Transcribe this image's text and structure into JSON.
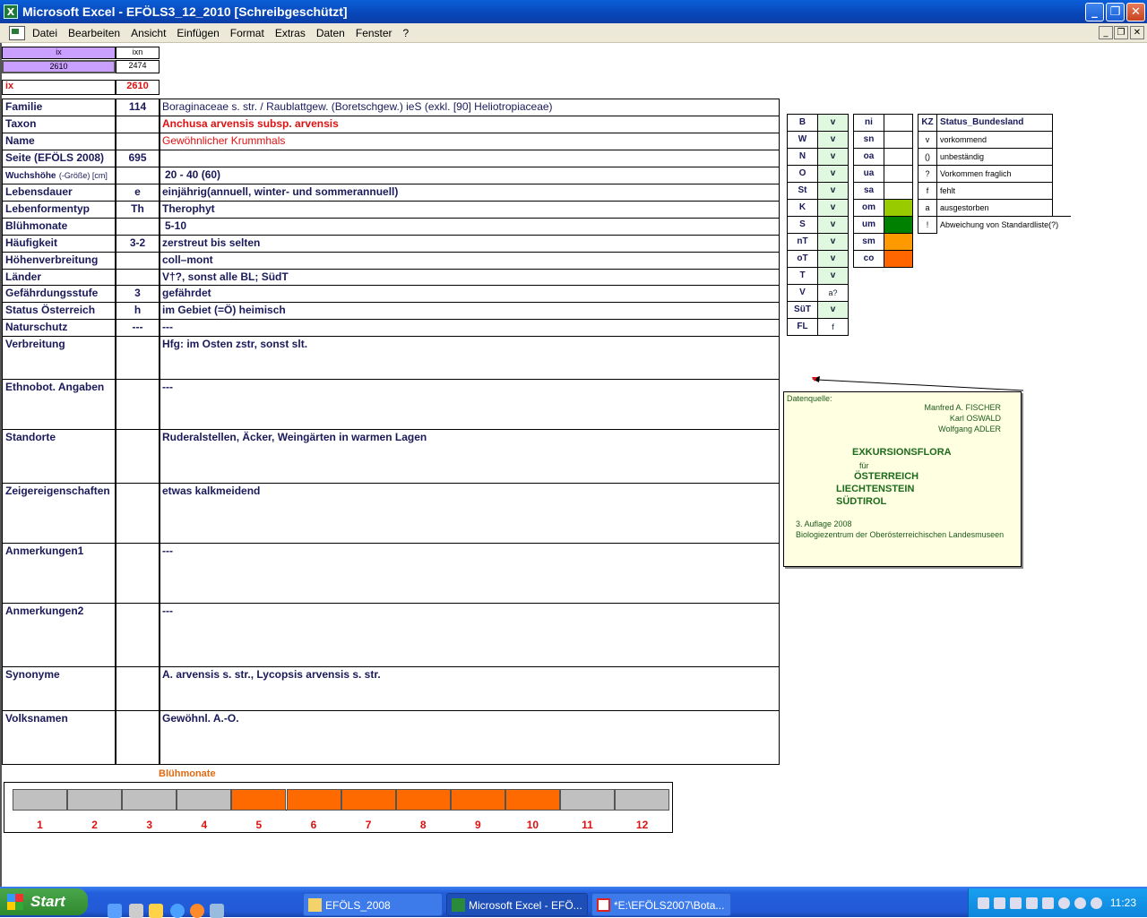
{
  "window": {
    "title": "Microsoft Excel - EFÖLS3_12_2010  [Schreibgeschützt]"
  },
  "menu": [
    "Datei",
    "Bearbeiten",
    "Ansicht",
    "Einfügen",
    "Format",
    "Extras",
    "Daten",
    "Fenster",
    "?"
  ],
  "top": {
    "ix_header": "ix",
    "ixn_header": "ixn",
    "ix_value": "2610",
    "ixn_value": "2474",
    "ix_label": "ix",
    "ix_red": "2610"
  },
  "rows": [
    {
      "label": "Familie",
      "code": "114",
      "value": "Boraginaceae s. str.  /  Raublattgew. (Boretschgew.) ieS (exkl. [90] Heliotropiaceae)"
    },
    {
      "label": "Taxon",
      "code": "",
      "value": "Anchusa arvensis subsp. arvensis"
    },
    {
      "label": "Name",
      "code": "",
      "value": "Gewöhnlicher Krummhals"
    },
    {
      "label": "Seite (EFÖLS 2008)",
      "code": "695",
      "value": ""
    },
    {
      "label": "Wuchshöhe",
      "label_suffix": "(-Größe) [cm]",
      "code": "",
      "value": "20 - 40 (60)"
    },
    {
      "label": "Lebensdauer",
      "code": "e",
      "value": "einjährig(annuell, winter- und sommerannuell)"
    },
    {
      "label": "Lebenformentyp",
      "code": "Th",
      "value": "Therophyt"
    },
    {
      "label": "Blühmonate",
      "code": "",
      "value": "5-10"
    },
    {
      "label": "Häufigkeit",
      "code": "3-2",
      "value": "zerstreut bis selten"
    },
    {
      "label": "Höhenverbreitung",
      "code": "",
      "value": "coll–mont"
    },
    {
      "label": "Länder",
      "code": "",
      "value": "V†?, sonst alle BL; SüdT"
    },
    {
      "label": "Gefährdungsstufe",
      "code": "3",
      "value": "gefährdet"
    },
    {
      "label": "Status Österreich",
      "code": "h",
      "value": "im Gebiet (=Ö) heimisch"
    },
    {
      "label": "Naturschutz",
      "code": "---",
      "value": "---"
    },
    {
      "label": "Verbreitung",
      "code": "",
      "value": "Hfg: im Osten zstr, sonst slt."
    },
    {
      "label": "Ethnobot. Angaben",
      "code": "",
      "value": "---"
    },
    {
      "label": "Standorte",
      "code": "",
      "value": "Ruderalstellen, Äcker, Weingärten in warmen Lagen"
    },
    {
      "label": "Zeigereigenschaften",
      "code": "",
      "value": "etwas kalkmeidend"
    },
    {
      "label": "Anmerkungen1",
      "code": "",
      "value": "---"
    },
    {
      "label": "Anmerkungen2",
      "code": "",
      "value": "---"
    },
    {
      "label": "Synonyme",
      "code": "",
      "value": "A. arvensis s. str., Lycopsis arvensis s. str."
    },
    {
      "label": "Volksnamen",
      "code": "",
      "value": "Gewöhnl. A.-O."
    }
  ],
  "states": [
    {
      "k": "B",
      "v": "v"
    },
    {
      "k": "W",
      "v": "v"
    },
    {
      "k": "N",
      "v": "v"
    },
    {
      "k": "O",
      "v": "v"
    },
    {
      "k": "St",
      "v": "v"
    },
    {
      "k": "K",
      "v": "v"
    },
    {
      "k": "S",
      "v": "v"
    },
    {
      "k": "nT",
      "v": "v"
    },
    {
      "k": "oT",
      "v": "v"
    },
    {
      "k": "T",
      "v": "v"
    },
    {
      "k": "V",
      "v": "a?"
    },
    {
      "k": "SüT",
      "v": "v"
    },
    {
      "k": "FL",
      "v": "f"
    }
  ],
  "codes": [
    {
      "k": "ni",
      "color": ""
    },
    {
      "k": "sn",
      "color": ""
    },
    {
      "k": "oa",
      "color": ""
    },
    {
      "k": "ua",
      "color": ""
    },
    {
      "k": "sa",
      "color": ""
    },
    {
      "k": "om",
      "color": "#99cc00"
    },
    {
      "k": "um",
      "color": "#008000"
    },
    {
      "k": "sm",
      "color": "#ff9900"
    },
    {
      "k": "co",
      "color": "#ff6600"
    }
  ],
  "status_legend": {
    "header_kz": "KZ",
    "header_title": "Status_Bundesland",
    "items": [
      {
        "k": "v",
        "t": "vorkommend"
      },
      {
        "k": "()",
        "t": "unbeständig"
      },
      {
        "k": "?",
        "t": "Vorkommen fraglich"
      },
      {
        "k": "f",
        "t": "fehlt"
      },
      {
        "k": "a",
        "t": "ausgestorben"
      },
      {
        "k": "!",
        "t": "Abweichung von Standardliste(?)"
      }
    ]
  },
  "note": {
    "source_label": "Datenquelle:",
    "authors": [
      "Manfred A. FISCHER",
      "Karl OSWALD",
      "Wolfgang ADLER"
    ],
    "title1": "EXKURSIONSFLORA",
    "fuer": "für",
    "title2": "ÖSTERREICH",
    "title3": "LIECHTENSTEIN",
    "title4": "SÜDTIROL",
    "edition": "3. Auflage 2008",
    "publisher": "Biologiezentrum der Oberösterreichischen Landesmuseen"
  },
  "chart_data": {
    "type": "bar",
    "title": "Blühmonate",
    "categories": [
      "1",
      "2",
      "3",
      "4",
      "5",
      "6",
      "7",
      "8",
      "9",
      "10",
      "11",
      "12"
    ],
    "values": [
      0,
      0,
      0,
      0,
      1,
      1,
      1,
      1,
      1,
      1,
      0,
      0
    ],
    "on_color": "#ff6a00",
    "off_color": "#c0c0c0"
  },
  "taskbar": {
    "start_label": "Start",
    "tasks": [
      "EFÖLS_2008",
      "Microsoft Excel - EFÖ...",
      "*E:\\EFÖLS2007\\Bota..."
    ],
    "clock": "11:23"
  }
}
